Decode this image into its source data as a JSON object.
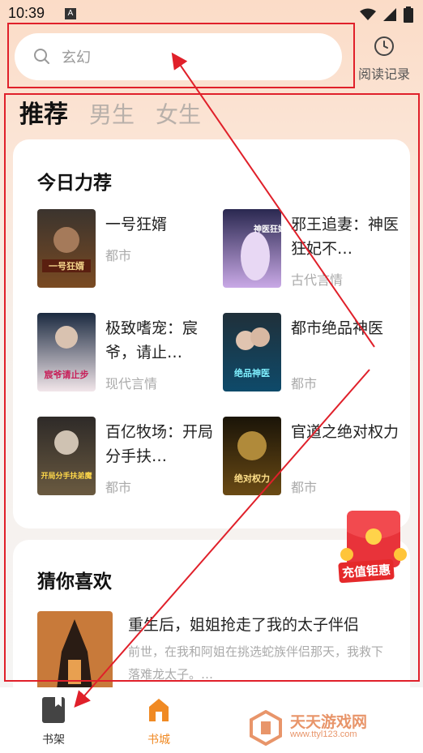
{
  "status": {
    "time": "10:39",
    "app_badge": "A"
  },
  "search": {
    "placeholder": "玄幻",
    "history_label": "阅读记录"
  },
  "tabs": [
    {
      "label": "推荐",
      "active": true
    },
    {
      "label": "男生",
      "active": false
    },
    {
      "label": "女生",
      "active": false
    }
  ],
  "daily": {
    "title": "今日力荐",
    "books": [
      {
        "title": "一号狂婿",
        "genre": "都市",
        "cover_text": "一号狂婿"
      },
      {
        "title": "邪王追妻：神医狂妃不…",
        "genre": "古代言情",
        "cover_text": "神医狂妃"
      },
      {
        "title": "极致嗜宠：宸爷，请止…",
        "genre": "现代言情",
        "cover_text": "宸爷请止步"
      },
      {
        "title": "都市绝品神医",
        "genre": "都市",
        "cover_text": "绝品神医"
      },
      {
        "title": "百亿牧场：开局分手扶…",
        "genre": "都市",
        "cover_text": "开局分手扶弟魔"
      },
      {
        "title": "官道之绝对权力",
        "genre": "都市",
        "cover_text": "绝对权力"
      }
    ]
  },
  "guess": {
    "title": "猜你喜欢",
    "book": {
      "title": "重生后，姐姐抢走了我的太子伴侣",
      "desc": "前世，在我和阿姐在挑选蛇族伴侣那天，我救下落难龙太子。…"
    }
  },
  "promo": {
    "label": "充值钜惠"
  },
  "nav": [
    {
      "label": "书架",
      "active": false
    },
    {
      "label": "书城",
      "active": true
    }
  ],
  "watermark": {
    "text": "天天游戏网",
    "url": "www.ttyl123.com"
  },
  "colors": {
    "accent": "#f08a24",
    "annotation": "#e0202a"
  }
}
